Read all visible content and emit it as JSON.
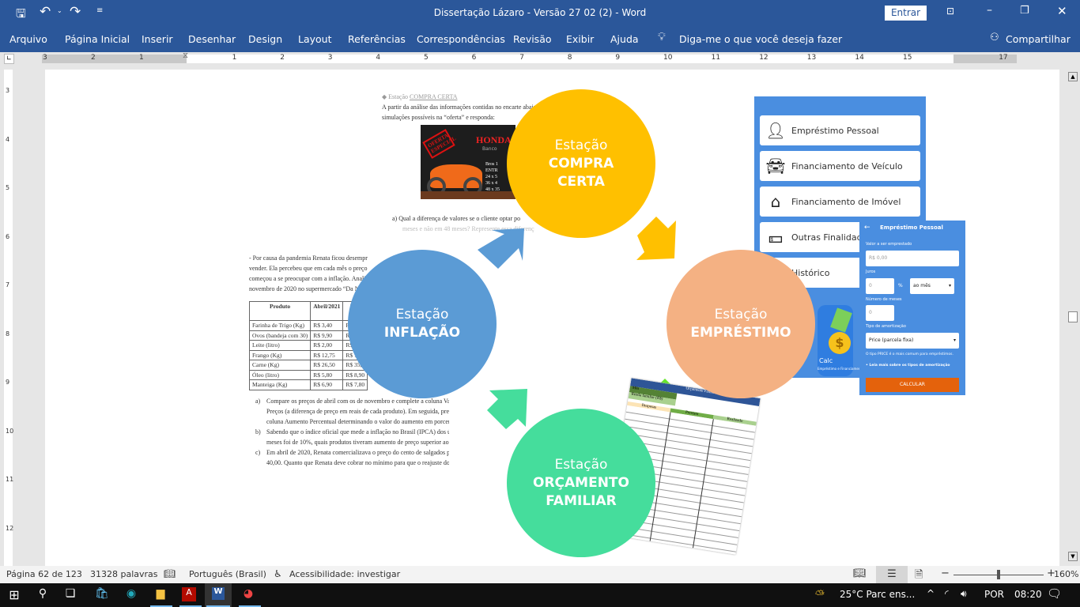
{
  "window": {
    "title": "Dissertação Lázaro - Versão 27 02 (2)  -  Word",
    "signin": "Entrar"
  },
  "ribbon": {
    "tabs": [
      "Arquivo",
      "Página Inicial",
      "Inserir",
      "Desenhar",
      "Design",
      "Layout",
      "Referências",
      "Correspondências",
      "Revisão",
      "Exibir",
      "Ajuda"
    ],
    "tell_me": "Diga-me o que você deseja fazer",
    "share": "Compartilhar"
  },
  "ruler": {
    "left": [
      "3",
      "2",
      "1"
    ],
    "right": [
      "1",
      "2",
      "3",
      "4",
      "5",
      "6",
      "7",
      "8",
      "9",
      "10",
      "11",
      "12",
      "13",
      "14",
      "15",
      "17"
    ],
    "vertical": [
      "3",
      "4",
      "5",
      "6",
      "7",
      "8",
      "9",
      "10",
      "11",
      "12"
    ]
  },
  "doc": {
    "compra": {
      "heading_prefix": "Estação ",
      "heading": "COMPRA CERTA",
      "lines": [
        "A partir da análise das informações contidas no encarte abaixo",
        "simulações possíveis na “oferta” e responda:"
      ],
      "ad_stamp": "OFERTA ESPECIAL",
      "ad_brand": "HONDA",
      "ad_sub": "Banco",
      "ad_lines": [
        "Bros 1",
        "ENTR",
        "24 x 5",
        "36 x 4",
        "48 x 35"
      ],
      "q_a": "a)  Qual a diferença de valores se o cliente optar po",
      "q_a2": "meses e não em 48 meses? Represente essa diferença"
    },
    "inflacao": {
      "lines": [
        "- Por causa da pandemia Renata ficou desempregada e d",
        "vender. Ela percebeu que em cada mês o preço de al",
        "começou a se preocupar com a inflação. Analise os",
        "novembro de 2020 no supermercado “Da Nossa"
      ],
      "table": {
        "headers": [
          "Produto",
          "Abril/2021",
          "Nov"
        ],
        "rows": [
          [
            "Farinha de Trigo (Kg)",
            "R$ 3,40",
            "R$"
          ],
          [
            "Ovos (bandeja com 30)",
            "R$ 9,90",
            "R$"
          ],
          [
            "Leite (litro)",
            "R$ 2,00",
            "R$ 2"
          ],
          [
            "Frango (Kg)",
            "R$ 12,75",
            "R$ 14"
          ],
          [
            "Carne (Kg)",
            "R$ 26,50",
            "R$ 35,2"
          ],
          [
            "Óleo (litro)",
            "R$ 5,80",
            "R$ 8,90"
          ],
          [
            "Manteiga (Kg)",
            "R$ 6,90",
            "R$ 7,80"
          ]
        ]
      },
      "questions": [
        [
          "a)",
          "Compare os preços de abril com os de novembro e complete a coluna Variação de",
          "Preços (a diferença de preço em reais de cada produto). Em seguida, preencha a",
          "coluna Aumento Percentual determinando o valor do aumento em porcentagem."
        ],
        [
          "b)",
          "Sabendo que o índice oficial que mede a inflação no Brasil (IPCA) dos últimos 6",
          "meses foi de 10%, quais produtos tiveram aumento de preço superior ao IPCA?"
        ],
        [
          "c)",
          "Em abril de 2020, Renata comercializava o preço do cento de salgados por R$",
          "40,00. Quanto que Renata deve cobrar no mínimo para que o reajuste do valor do"
        ]
      ]
    }
  },
  "stations": [
    {
      "line1": "Estação",
      "line2": "COMPRA",
      "line3": "CERTA",
      "color": "#FFC000"
    },
    {
      "line1": "Estação",
      "line2": "EMPRÉSTIMO",
      "line3": "",
      "color": "#F4B183"
    },
    {
      "line1": "Estação",
      "line2": "INFLAÇÃO",
      "line3": "",
      "color": "#5B9BD5"
    },
    {
      "line1": "Estação",
      "line2": "ORÇAMENTO",
      "line3": "FAMILIAR",
      "color": "#45DD9C"
    }
  ],
  "app": {
    "menu": [
      "Empréstimo Pessoal",
      "Financiamento de Veículo",
      "Financiamento de Imóvel",
      "Outras Finalidades",
      "Histórico"
    ],
    "logo": "Calc",
    "logo_sub": "Empréstimo e Financiamento",
    "form": {
      "title": "Empréstimo Pessoal",
      "valor_label": "Valor a ser emprestado",
      "valor_ph": "R$ 0,00",
      "juros_label": "Juros",
      "juros_ph": "0",
      "pct": "%",
      "periodo": "ao mês",
      "meses_label": "Número de meses",
      "meses_ph": "0",
      "tipo_label": "Tipo de amortização",
      "tipo": "Price (parcela fixa)",
      "hint": "O tipo PRICE é o mais comum para empréstimos.",
      "link": "• Leia mais sobre os tipos de amortização",
      "button": "CALCULAR"
    }
  },
  "sheet": {
    "title": "Orçamento Familiar",
    "mes": "Mês",
    "renda": "Renda familiar (R$)",
    "despesas": "Despesas",
    "previsto": "Previsto",
    "realizado": "Realizado"
  },
  "status": {
    "page": "Página 62 de 123",
    "words": "31328 palavras",
    "language": "Português (Brasil)",
    "accessibility": "Acessibilidade: investigar",
    "zoom": "160%",
    "zoom_percent": 160
  },
  "taskbar": {
    "weather": "25°C  Parc ens...",
    "lang": "POR",
    "time": "08:20"
  }
}
